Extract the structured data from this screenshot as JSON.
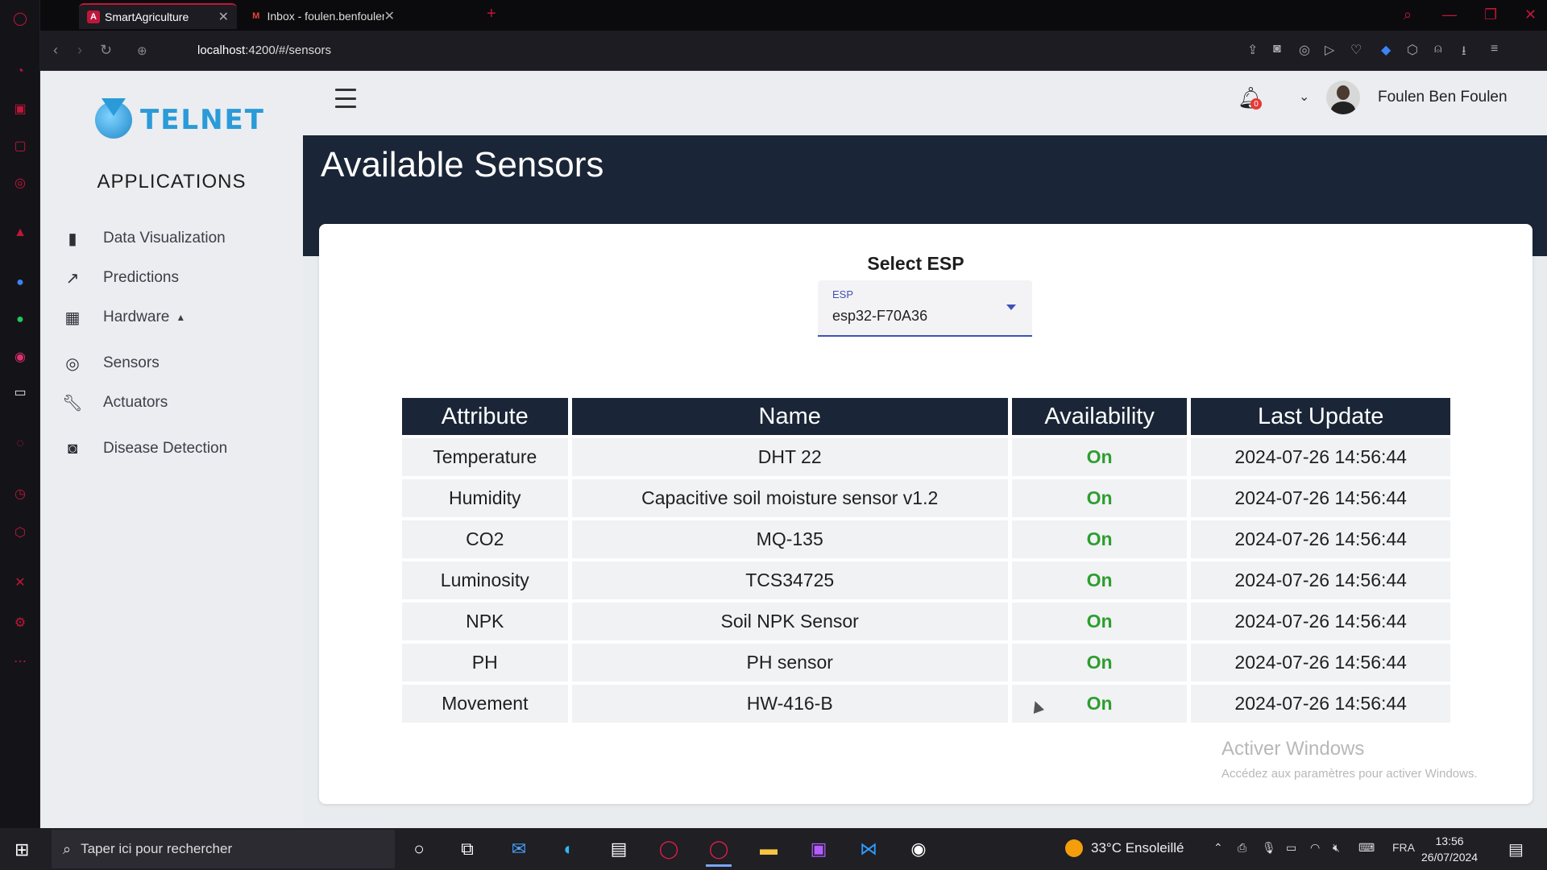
{
  "browser": {
    "tabs": [
      {
        "title": "SmartAgriculture",
        "favicon": "A",
        "favicon_color": "#c0163a"
      },
      {
        "title": "Inbox - foulen.benfoulen.t",
        "favicon": "M",
        "favicon_color": "#ea4335"
      }
    ],
    "url_host": "localhost",
    "url_path": ":4200/#/sensors"
  },
  "sidebar": {
    "logo_text": "TELNET",
    "section_title": "APPLICATIONS",
    "items": [
      {
        "label": "Data Visualization",
        "icon": "bar-chart-icon"
      },
      {
        "label": "Predictions",
        "icon": "trend-icon"
      },
      {
        "label": "Hardware",
        "icon": "chip-icon"
      },
      {
        "label": "Sensors",
        "icon": "sensor-icon"
      },
      {
        "label": "Actuators",
        "icon": "wrench-icon"
      },
      {
        "label": "Disease Detection",
        "icon": "camera-icon"
      }
    ]
  },
  "header": {
    "notification_count": "0",
    "user_name": "Foulen Ben Foulen"
  },
  "page": {
    "title": "Available Sensors",
    "select_label": "Select ESP",
    "select_float_label": "ESP",
    "select_value": "esp32-F70A36"
  },
  "table": {
    "headers": [
      "Attribute",
      "Name",
      "Availability",
      "Last Update"
    ],
    "rows": [
      [
        "Temperature",
        "DHT 22",
        "On",
        "2024-07-26 14:56:44"
      ],
      [
        "Humidity",
        "Capacitive soil moisture sensor v1.2",
        "On",
        "2024-07-26 14:56:44"
      ],
      [
        "CO2",
        "MQ-135",
        "On",
        "2024-07-26 14:56:44"
      ],
      [
        "Luminosity",
        "TCS34725",
        "On",
        "2024-07-26 14:56:44"
      ],
      [
        "NPK",
        "Soil NPK Sensor",
        "On",
        "2024-07-26 14:56:44"
      ],
      [
        "PH",
        "PH sensor",
        "On",
        "2024-07-26 14:56:44"
      ],
      [
        "Movement",
        "HW-416-B",
        "On",
        "2024-07-26 14:56:44"
      ]
    ]
  },
  "watermark": {
    "line1": "Activer Windows",
    "line2": "Accédez aux paramètres pour activer Windows."
  },
  "taskbar": {
    "search_placeholder": "Taper ici pour rechercher",
    "weather": "33°C  Ensoleillé",
    "lang": "FRA",
    "time": "13:56",
    "date": "26/07/2024"
  },
  "colors": {
    "navy": "#1a2637",
    "on_green": "#2e9e2e",
    "accent": "#3f51b5",
    "opera_red": "#c0163a"
  }
}
